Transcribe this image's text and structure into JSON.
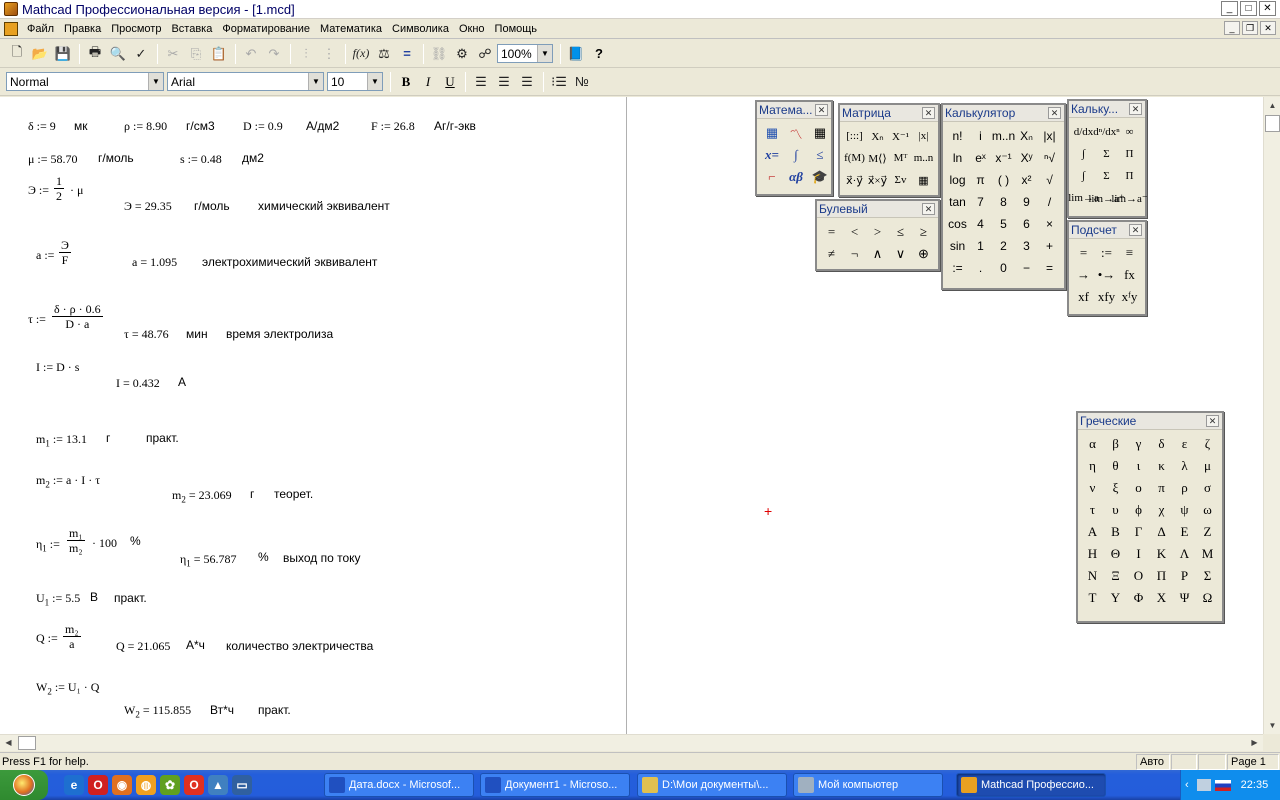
{
  "window": {
    "title": "Mathcad Профессиональная версия - [1.mcd]",
    "minimize": "_",
    "maximize": "□",
    "close": "✕"
  },
  "menu": [
    "Файл",
    "Правка",
    "Просмотр",
    "Вставка",
    "Форматирование",
    "Математика",
    "Символика",
    "Окно",
    "Помощь"
  ],
  "toolbar": {
    "zoom": "100%"
  },
  "format": {
    "style": "Normal",
    "font": "Arial",
    "size": "10",
    "bold": "B",
    "italic": "I",
    "underline": "U"
  },
  "doc": {
    "delta_def": "δ := 9",
    "delta_unit": "мк",
    "rho_def": "ρ := 8.90",
    "rho_unit": "г/см3",
    "D_def": "D := 0.9",
    "D_unit": "А/дм2",
    "F_def": "F := 26.8",
    "F_unit": "Аг/г-экв",
    "mu_def": "μ := 58.70",
    "mu_unit": "г/моль",
    "s_def": "s := 0.48",
    "s_unit": "дм2",
    "E_lhs": "Э :=",
    "E_num": "1",
    "E_den": "2",
    "E_rhs": "· μ",
    "E_res": "Э = 29.35",
    "E_unit": "г/моль",
    "E_desc": "химический эквивалент",
    "a_lhs": "a :=",
    "a_num": "Э",
    "a_den": "F",
    "a_res": "a = 1.095",
    "a_desc": "электрохимический эквивалент",
    "tau_lhs": "τ :=",
    "tau_num": "δ · ρ · 0.6",
    "tau_den": "D · a",
    "tau_res": "τ = 48.76",
    "tau_unit": "мин",
    "tau_desc": "время электролиза",
    "I_def": "I := D · s",
    "I_res": "I = 0.432",
    "I_unit": "A",
    "m1_def": "m",
    "m1_sub": "1",
    "m1_rhs": ":= 13.1",
    "m1_unit": "г",
    "m1_desc": "практ.",
    "m2_def": "m",
    "m2_sub": "2",
    "m2_rhs": ":= a · I · τ",
    "m2_res_l": "m",
    "m2_res_sub": "2",
    "m2_res_r": "= 23.069",
    "m2_unit": "г",
    "m2_desc": "теорет.",
    "eta_l": "η",
    "eta_sub": "1",
    "eta_assign": ":=",
    "eta_num": "m₁",
    "eta_den": "m₂",
    "eta_rhs": "· 100",
    "eta_pct": "%",
    "eta_res_l": "η",
    "eta_res_sub": "1",
    "eta_res_r": "= 56.787",
    "eta_res_pct": "%",
    "eta_desc": "выход по току",
    "U_l": "U",
    "U_sub": "1",
    "U_rhs": ":= 5.5",
    "U_unit": "В",
    "U_desc": "практ.",
    "Q_lhs": "Q :=",
    "Q_num": "m₂",
    "Q_den": "a",
    "Q_res": "Q = 21.065",
    "Q_unit": "А*ч",
    "Q_desc": "количество электричества",
    "W_l": "W",
    "W_sub": "2",
    "W_rhs": ":= U₁ · Q",
    "W_res_l": "W",
    "W_res_sub": "2",
    "W_res_r": "= 115.855",
    "W_unit": "Вт*ч",
    "W_desc": "практ."
  },
  "palettes": {
    "math": {
      "title": "Матема..."
    },
    "matrix": {
      "title": "Матрица",
      "buttons": [
        "[:::]",
        "Xₙ",
        "X⁻¹",
        "|x|",
        "f(M)",
        "M⟨⟩",
        "Mᵀ",
        "m..n",
        "x⃗·y⃗",
        "x⃗×y⃗",
        "Σv",
        "▦"
      ]
    },
    "boolean": {
      "title": "Булевый",
      "buttons": [
        "=",
        "<",
        ">",
        "≤",
        "≥",
        "≠",
        "¬",
        "∧",
        "∨",
        "⊕"
      ]
    },
    "calculator": {
      "title": "Калькулятор",
      "buttons": [
        "n!",
        "i",
        "m..n",
        "Xₙ",
        "|x|",
        "ln",
        "eˣ",
        "x⁻¹",
        "Xʸ",
        "ⁿ√",
        "log",
        "π",
        "( )",
        "x²",
        "√",
        "tan",
        "7",
        "8",
        "9",
        "/",
        "cos",
        "4",
        "5",
        "6",
        "×",
        "sin",
        "1",
        "2",
        "3",
        "+",
        ":=",
        ".",
        "0",
        "−",
        "="
      ]
    },
    "calculus": {
      "title": "Кальку...",
      "buttons": [
        "d/dx",
        "dⁿ/dxⁿ",
        "∞",
        "∫",
        "Σ",
        "Π",
        "∫",
        "Σ",
        "Π",
        "lim→a",
        "lim→a⁺",
        "lim→a⁻"
      ]
    },
    "eval": {
      "title": "Подсчет",
      "buttons": [
        "=",
        ":=",
        "≡",
        "→",
        "•→",
        "fx",
        "xf",
        "xfy",
        "xᶠy"
      ]
    },
    "greek": {
      "title": "Греческие",
      "letters": [
        "α",
        "β",
        "γ",
        "δ",
        "ε",
        "ζ",
        "η",
        "θ",
        "ι",
        "κ",
        "λ",
        "μ",
        "ν",
        "ξ",
        "ο",
        "π",
        "ρ",
        "σ",
        "τ",
        "υ",
        "ϕ",
        "χ",
        "ψ",
        "ω",
        "Α",
        "Β",
        "Γ",
        "Δ",
        "Ε",
        "Ζ",
        "Η",
        "Θ",
        "Ι",
        "Κ",
        "Λ",
        "Μ",
        "Ν",
        "Ξ",
        "Ο",
        "Π",
        "Ρ",
        "Σ",
        "Τ",
        "Υ",
        "Φ",
        "Χ",
        "Ψ",
        "Ω"
      ]
    }
  },
  "cursor": "+",
  "status": {
    "help": "Press F1 for help.",
    "mode": "Авто",
    "page": "Page 1"
  },
  "taskbar": {
    "tasks": [
      "Дата.docx - Microsof...",
      "Документ1 - Microso...",
      "D:\\Мои документы\\...",
      "Мой компьютер",
      "Mathcad Профессио..."
    ],
    "clock": "22:35"
  }
}
